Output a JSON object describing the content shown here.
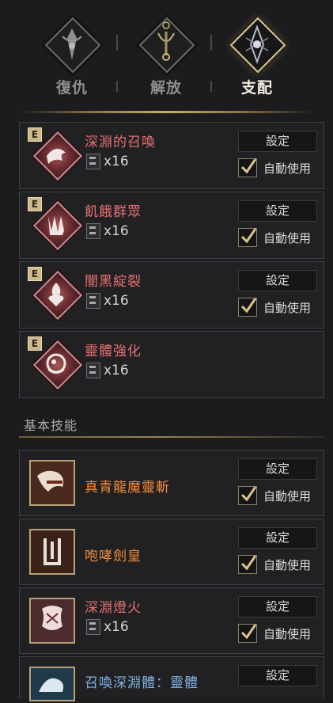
{
  "tabs": [
    {
      "label": "復仇",
      "icon": "vengeance-emblem-icon",
      "active": false
    },
    {
      "label": "解放",
      "icon": "liberation-emblem-icon",
      "active": false
    },
    {
      "label": "支配",
      "icon": "domination-emblem-icon",
      "active": true
    }
  ],
  "class_skills": [
    {
      "badge": "E",
      "name": "深淵的召喚",
      "count": "x16",
      "set_label": "設定",
      "auto_label": "自動使用",
      "auto_checked": true
    },
    {
      "badge": "E",
      "name": "飢餓群眾",
      "count": "x16",
      "set_label": "設定",
      "auto_label": "自動使用",
      "auto_checked": true
    },
    {
      "badge": "E",
      "name": "闇黑綻裂",
      "count": "x16",
      "set_label": "設定",
      "auto_label": "自動使用",
      "auto_checked": true
    },
    {
      "badge": "E",
      "name": "靈體強化",
      "count": "x16"
    }
  ],
  "basic_section": {
    "title": "基本技能"
  },
  "basic_skills": [
    {
      "name": "真青龍魔靈斬",
      "set_label": "設定",
      "auto_label": "自動使用",
      "auto_checked": true
    },
    {
      "name": "咆哮劍皇",
      "set_label": "設定",
      "auto_label": "自動使用",
      "auto_checked": true
    },
    {
      "name": "深淵燈火",
      "count": "x16",
      "set_label": "設定",
      "auto_label": "自動使用",
      "auto_checked": true
    },
    {
      "name": "召喚深淵體：靈體",
      "set_label": "設定"
    }
  ],
  "colors": {
    "accent_gold": "#c7ad70",
    "skill_red": "#e87070",
    "skill_orange": "#f08a3a",
    "skill_blue": "#7fb0e0"
  }
}
